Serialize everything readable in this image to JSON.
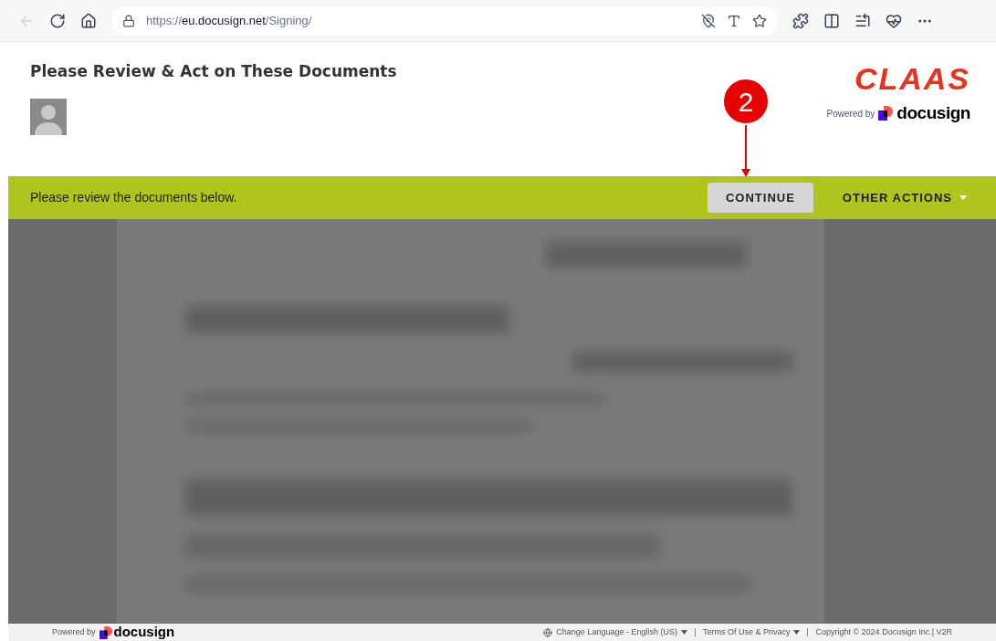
{
  "browser": {
    "url_scheme": "https://",
    "url_host": "eu.docusign.net",
    "url_path": "/Signing/"
  },
  "header": {
    "title": "Please Review & Act on These Documents",
    "brand": "CLAAS",
    "powered_by": "Powered by",
    "provider": "docusign"
  },
  "action_bar": {
    "message": "Please review the documents below.",
    "continue": "CONTINUE",
    "other_actions": "OTHER ACTIONS"
  },
  "annotation": {
    "label": "2"
  },
  "footer": {
    "powered_by": "Powered by",
    "provider": "docusign",
    "links": [
      {
        "label": "Change Language - English (US)",
        "kind": "language"
      },
      {
        "label": "Terms Of Use & Privacy",
        "kind": "menu"
      }
    ],
    "copyright": "Copyright © 2024 Docusign Inc.| V2R"
  }
}
